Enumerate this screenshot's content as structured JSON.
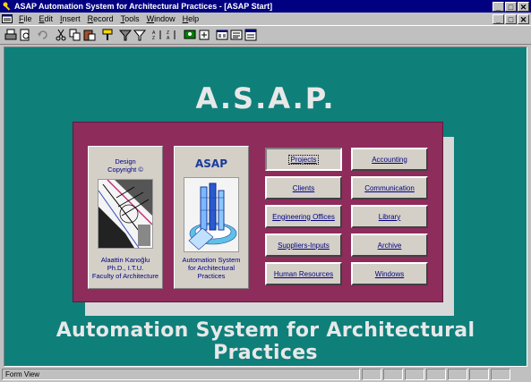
{
  "window": {
    "title": "ASAP Automation System for Architectural Practices - [ASAP Start]",
    "minimize": "_",
    "maximize": "□",
    "close": "✕"
  },
  "menu": {
    "items": [
      {
        "u": "F",
        "rest": "ile"
      },
      {
        "u": "E",
        "rest": "dit"
      },
      {
        "u": "I",
        "rest": "nsert"
      },
      {
        "u": "R",
        "rest": "ecord"
      },
      {
        "u": "T",
        "rest": "ools"
      },
      {
        "u": "W",
        "rest": "indow"
      },
      {
        "u": "H",
        "rest": "elp"
      }
    ]
  },
  "toolbar": {
    "icons": [
      "print-icon",
      "preview-icon",
      "undo-icon",
      "cut-icon",
      "copy-icon",
      "paste-icon",
      "format-painter-icon",
      "filter-icon",
      "filter-form-icon",
      "sort-ascending-icon",
      "sort-descending-icon",
      "find-icon",
      "new-record-icon",
      "database-window-icon",
      "properties-icon"
    ]
  },
  "form": {
    "title": "A.S.A.P.",
    "subtitle": "Automation System for Architectural Practices",
    "card1": {
      "line1": "Design",
      "line2": "Copyright ©",
      "line3": "Alaattin Kanoğlu",
      "line4": "Ph.D., I.T.U.",
      "line5": "Faculty of Architecture"
    },
    "card2": {
      "tag": "ASAP",
      "line1": "Automation System",
      "line2": "for Architectural",
      "line3": "Practices"
    },
    "buttons_left": [
      "Projects",
      "Clients",
      "Engineering Offices",
      "Suppliers-Inputs",
      "Human Resources"
    ],
    "buttons_right": [
      "Accounting",
      "Communication",
      "Library",
      "Archive",
      "Windows"
    ]
  },
  "status": {
    "text": "Form View"
  },
  "colors": {
    "background": "#0f7f7a",
    "panel": "#8e2c5c",
    "titlebar": "#000080"
  }
}
